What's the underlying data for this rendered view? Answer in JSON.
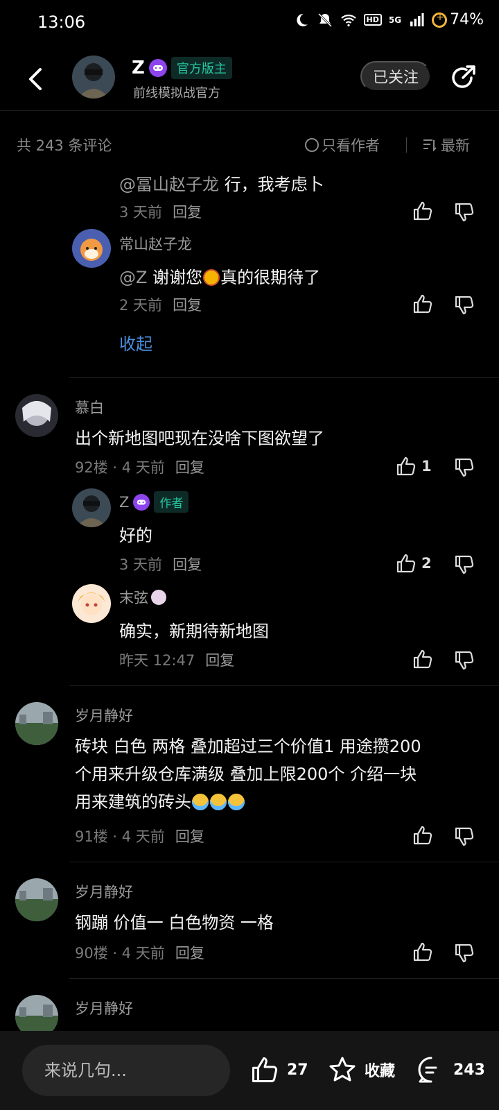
{
  "status": {
    "time": "13:06",
    "hd": "HD",
    "network": "5G",
    "battery": "74%",
    "icons": [
      "moon-icon",
      "bell-mute-icon",
      "wifi-icon",
      "signal-icon",
      "battery-icon"
    ]
  },
  "header": {
    "name": "Z",
    "badge": "官方版主",
    "subtitle": "前线模拟战官方",
    "follow_label": "已关注"
  },
  "comment_bar": {
    "count": "共 243 条评论",
    "author_only": "只看作者",
    "sort": "最新"
  },
  "thread1": {
    "reply1": {
      "mention": "@冨山赵子龙",
      "text": "行，我考虑卜",
      "meta": "3 天前",
      "reply": "回复"
    },
    "reply2": {
      "name": "常山赵子龙",
      "mention": "@Z",
      "text_before": "谢谢您",
      "text_after": "真的很期待了",
      "meta": "2 天前",
      "reply": "回复"
    },
    "collapse": "收起"
  },
  "comment92": {
    "name": "慕白",
    "text": "出个新地图吧现在没啥下图欲望了",
    "meta": "92楼 · 4 天前",
    "reply": "回复",
    "likes": "1",
    "reply1": {
      "name": "Z",
      "tag": "作者",
      "text": "好的",
      "meta": "3 天前",
      "reply": "回复",
      "likes": "2"
    },
    "reply2": {
      "name": "末弦",
      "text": "确实，新期待新地图",
      "meta": "昨天 12:47",
      "reply": "回复"
    }
  },
  "comment91": {
    "name": "岁月静好",
    "line1": "砖块  白色 两格 叠加超过三个价值1 用途攒200",
    "line2": "个用来升级仓库满级 叠加上限200个 介绍一块",
    "line3": "用来建筑的砖头",
    "meta": "91楼 · 4 天前",
    "reply": "回复"
  },
  "comment90": {
    "name": "岁月静好",
    "text": "钢蹦 价值一 白色物资 一格",
    "meta": "90楼 · 4 天前",
    "reply": "回复"
  },
  "comment89": {
    "name": "岁月静好"
  },
  "bottom": {
    "placeholder": "来说几句...",
    "likes": "27",
    "favorite": "收藏",
    "comments": "243"
  }
}
